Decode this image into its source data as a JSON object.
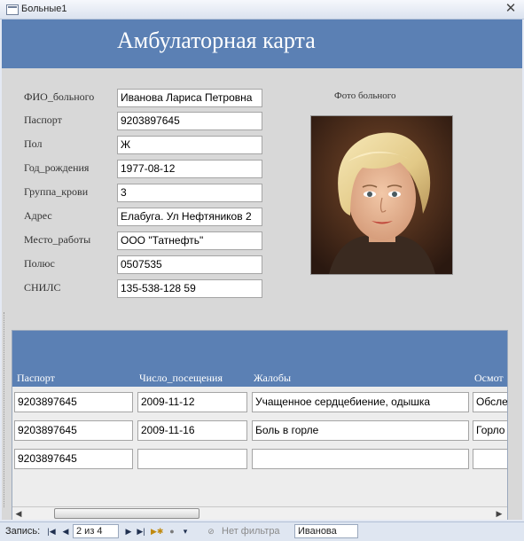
{
  "window": {
    "title": "Больные1"
  },
  "header": {
    "title": "Амбулаторная карта"
  },
  "patient_fields": [
    {
      "label": "ФИО_больного",
      "value": "Иванова Лариса Петровна"
    },
    {
      "label": "Паспорт",
      "value": "9203897645"
    },
    {
      "label": "Пол",
      "value": "Ж"
    },
    {
      "label": "Год_рождения",
      "value": "1977-08-12"
    },
    {
      "label": "Группа_крови",
      "value": "3"
    },
    {
      "label": "Адрес",
      "value": "Елабуга. Ул Нефтяников 2"
    },
    {
      "label": "Место_работы",
      "value": "ООО \"Татнефть\""
    },
    {
      "label": "Полюс",
      "value": "0507535"
    },
    {
      "label": "СНИЛС",
      "value": "135-538-128 59"
    }
  ],
  "photo": {
    "label": "Фото больного"
  },
  "visits": {
    "columns": [
      "Паспорт",
      "Число_посещения",
      "Жалобы",
      "Осмот"
    ],
    "rows": [
      [
        "9203897645",
        "2009-11-12",
        "Учащенное сердцебиение, одышка",
        "Обсле"
      ],
      [
        "9203897645",
        "2009-11-16",
        "Боль в горле",
        "Горло"
      ],
      [
        "9203897645",
        "",
        "",
        ""
      ]
    ]
  },
  "navigation": {
    "record_label": "Запись:",
    "position": "2 из 4",
    "filter_label": "Нет фильтра",
    "search_value": "Иванова"
  }
}
